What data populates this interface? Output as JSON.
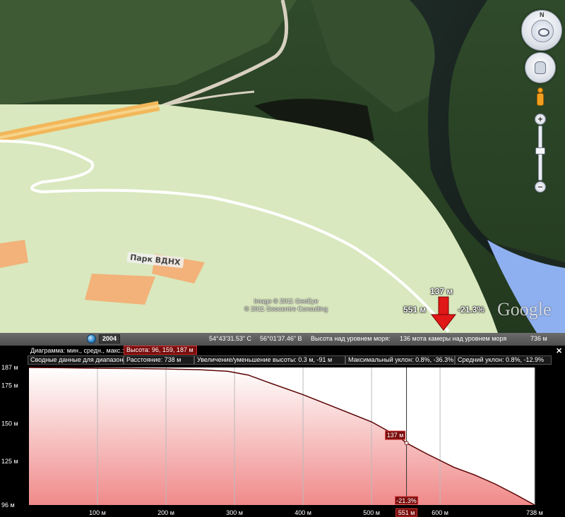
{
  "map": {
    "park_label": "Парк ВДНХ",
    "imagery_credit": [
      "Image © 2011 GeoEye",
      "© 2011 Geocentre Consulting"
    ],
    "logo": "Google",
    "marker": {
      "height": "137 м",
      "distance": "551 м",
      "slope": "-21.3%"
    },
    "controls": {
      "north_label": "N",
      "zoom_in": "+",
      "zoom_out": "−"
    }
  },
  "status_bar": {
    "year": "2004",
    "lat": "54°43'31.53\" С",
    "lon": "56°01'37.46\" В",
    "elevation_label": "Высота над уровнем моря:",
    "elevation_value": "136 м",
    "camera_label": "ота камеры над уровнем моря",
    "camera_value": "736 м"
  },
  "profile": {
    "header": {
      "label": "Диаграмма: мин., средн., макс.:",
      "selected": "Высота: 96, 159, 187 м",
      "close": "✕"
    },
    "summary": {
      "title": "Сводные данные для диапазона:",
      "distance": "Расстояние: 738 м",
      "gain_loss": "Увеличение/уменьшение высоты: 0.3 м, -91 м",
      "max_slope": "Максимальный уклон: 0.8%, -36.3%",
      "avg_slope": "Средний уклон: 0.8%, -12.9%"
    }
  },
  "chart_data": {
    "type": "area",
    "title": "",
    "xlabel": "",
    "ylabel": "",
    "x_unit": "м",
    "xlim": [
      0,
      738
    ],
    "ylim": [
      96,
      187
    ],
    "y_ticks": [
      96,
      125,
      150,
      175,
      187
    ],
    "y_tick_labels": [
      "96 м",
      "125 м",
      "150 м",
      "175 м",
      "187 м"
    ],
    "x_ticks": [
      100,
      200,
      300,
      400,
      500,
      551,
      600,
      738
    ],
    "x_tick_labels": [
      "100 м",
      "200 м",
      "300 м",
      "400 м",
      "500 м",
      "551 м",
      "600 м",
      "738 м"
    ],
    "grid": true,
    "series": [
      {
        "x": [
          0,
          50,
          100,
          150,
          200,
          250,
          290,
          320,
          350,
          400,
          450,
          500,
          540,
          551,
          580,
          620,
          650,
          680,
          710,
          738
        ],
        "y": [
          187,
          186.8,
          186.5,
          186.3,
          186,
          185.5,
          184.5,
          182,
          177,
          169,
          160,
          151,
          141,
          137,
          130,
          121,
          116,
          110,
          103,
          96
        ]
      }
    ],
    "cursor": {
      "x": 551,
      "y": 137,
      "label": "137 м",
      "slope_label": "-21.3%"
    },
    "colors": {
      "fill_top": "#ffffff",
      "fill_bottom": "#f08a8a",
      "line": "#5a0000",
      "cursor": "#333333"
    }
  }
}
